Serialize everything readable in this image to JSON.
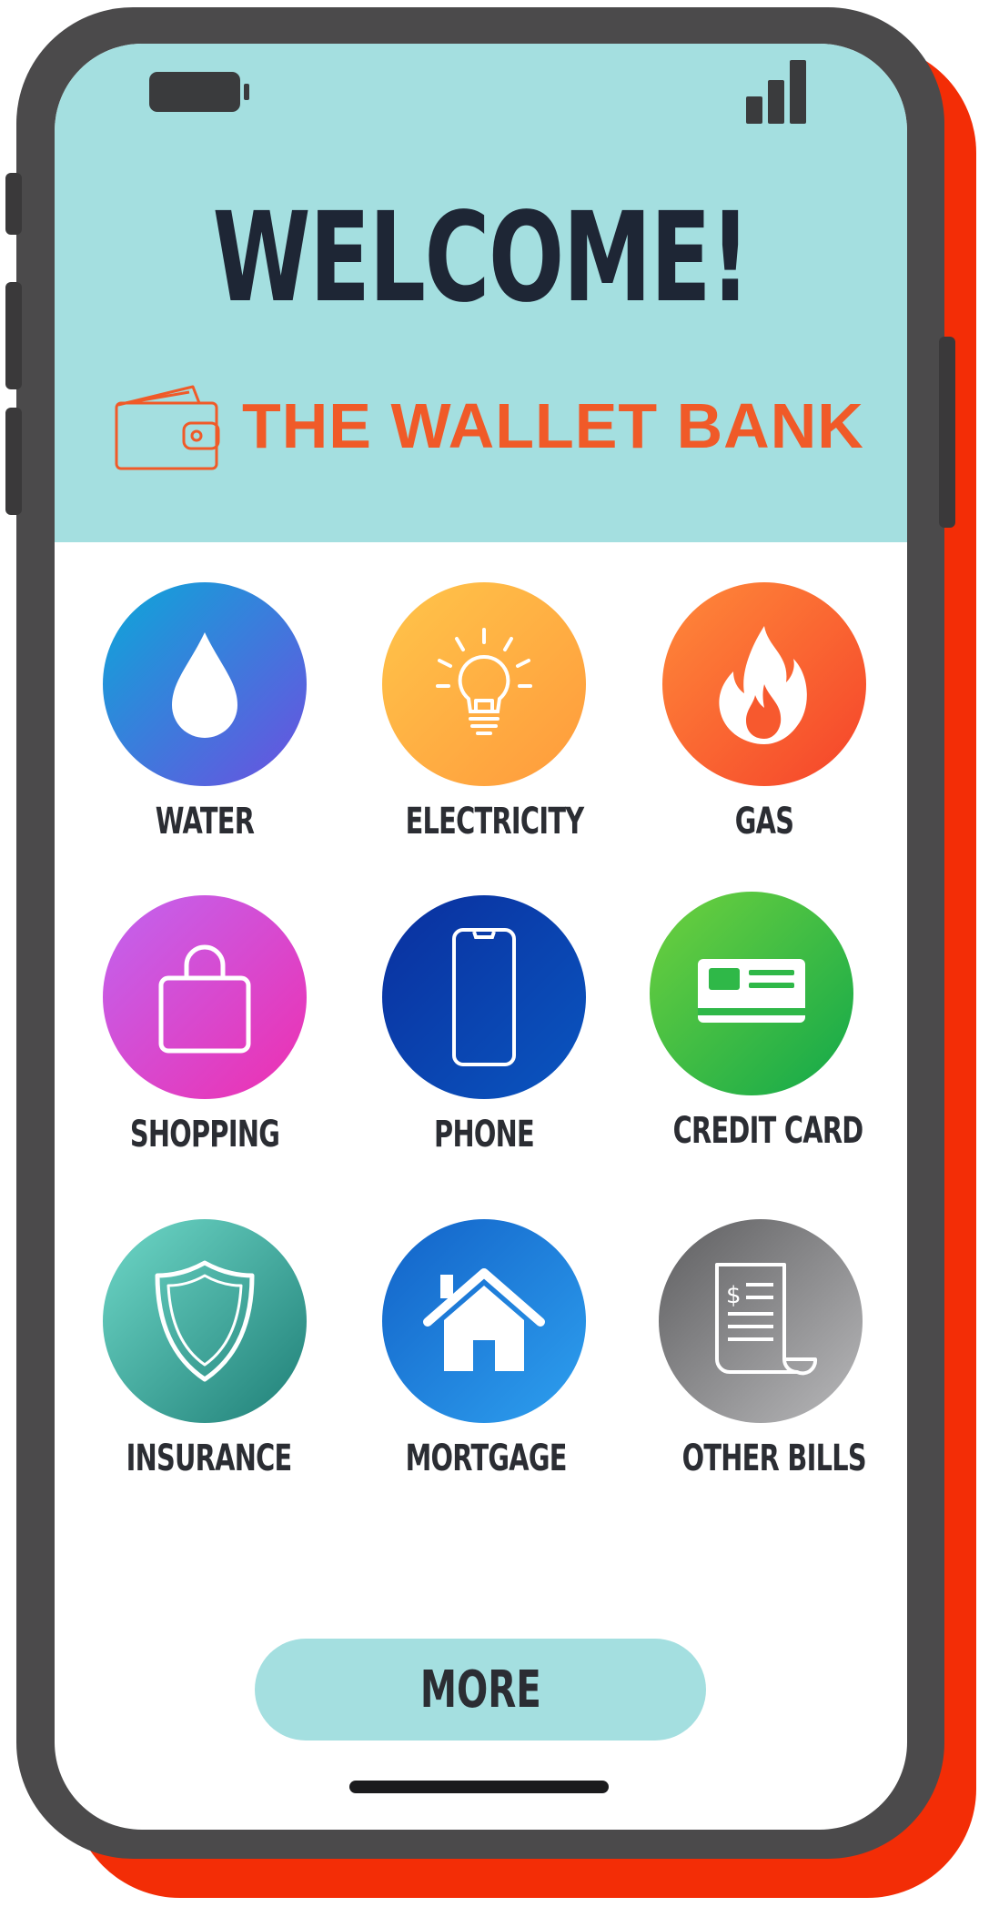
{
  "header": {
    "title": "WELCOME!",
    "brand": "THE WALLET BANK"
  },
  "status_bar": {
    "battery_icon": "battery-icon",
    "signal_icon": "signal-bars-icon"
  },
  "categories": [
    {
      "label": "WATER",
      "icon": "water-drop-icon",
      "colors": [
        "#0ba8d8",
        "#6d4fe0"
      ]
    },
    {
      "label": "ELECTRICITY",
      "icon": "light-bulb-icon",
      "colors": [
        "#ffc54a",
        "#ff9a3c"
      ]
    },
    {
      "label": "GAS",
      "icon": "flame-icon",
      "colors": [
        "#ff8a3a",
        "#f5432a"
      ]
    },
    {
      "label": "SHOPPING",
      "icon": "shopping-bag-icon",
      "colors": [
        "#c065f0",
        "#ee2fb0"
      ]
    },
    {
      "label": "PHONE",
      "icon": "smartphone-icon",
      "colors": [
        "#0a2f9e",
        "#0a56c0"
      ]
    },
    {
      "label": "CREDIT CARD",
      "icon": "credit-card-icon",
      "colors": [
        "#6fd13e",
        "#12a84a"
      ]
    },
    {
      "label": "INSURANCE",
      "icon": "shield-icon",
      "colors": [
        "#6fd8c8",
        "#1f7f77"
      ]
    },
    {
      "label": "MORTGAGE",
      "icon": "house-icon",
      "colors": [
        "#1262c8",
        "#2ea0ef"
      ]
    },
    {
      "label": "OTHER BILLS",
      "icon": "receipt-icon",
      "colors": [
        "#5e5e60",
        "#b9b9bb"
      ]
    }
  ],
  "more_button": {
    "label": "MORE"
  },
  "colors": {
    "header_bg": "#a4dfe0",
    "brand": "#f05a28",
    "title": "#1e2635",
    "phone_frame": "#4b4a4b",
    "phone_shadow": "#f32d06"
  }
}
